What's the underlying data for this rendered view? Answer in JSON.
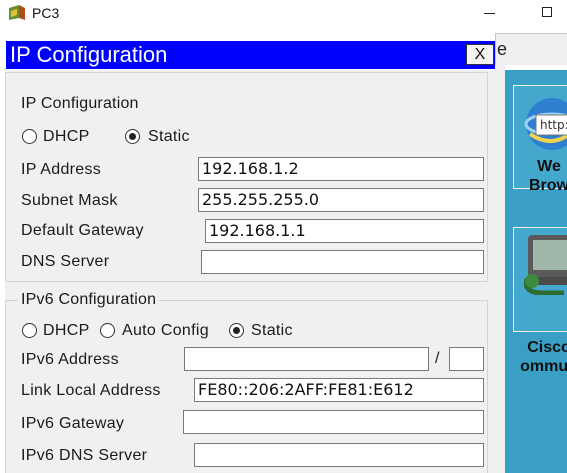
{
  "window": {
    "title": "PC3"
  },
  "background_tab": {
    "label_fragment": "e"
  },
  "desktop": {
    "apps": [
      {
        "label_line1": "We",
        "label_line2": "Brow",
        "icon_text": "http:"
      },
      {
        "label_line1": "Cisco",
        "label_line2": "ommun"
      }
    ]
  },
  "dialog": {
    "title": "IP Configuration",
    "close_label": "X",
    "ipv4": {
      "group_title": "IP Configuration",
      "dhcp_label": "DHCP",
      "static_label": "Static",
      "selected": "Static",
      "ip_address_label": "IP Address",
      "ip_address": "192.168.1.2",
      "subnet_mask_label": "Subnet Mask",
      "subnet_mask": "255.255.255.0",
      "gateway_label": "Default Gateway",
      "gateway": "192.168.1.1",
      "dns_label": "DNS Server",
      "dns": ""
    },
    "ipv6": {
      "group_title": "IPv6 Configuration",
      "dhcp_label": "DHCP",
      "auto_label": "Auto Config",
      "static_label": "Static",
      "selected": "Static",
      "address_label": "IPv6 Address",
      "address": "",
      "slash": "/",
      "prefix": "",
      "link_local_label": "Link Local Address",
      "link_local": "FE80::206:2AFF:FE81:E612",
      "gateway_label": "IPv6 Gateway",
      "gateway": "",
      "dns_label": "IPv6 DNS Server",
      "dns": ""
    }
  },
  "colors": {
    "dialog_title_bg": "#0000ff",
    "desktop_bg": "#3a9fc5"
  }
}
